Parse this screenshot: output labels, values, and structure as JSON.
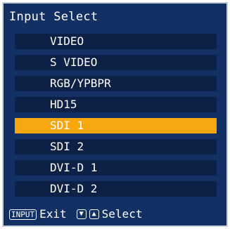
{
  "menu": {
    "title": "Input Select",
    "items": [
      {
        "label": "VIDEO",
        "selected": false
      },
      {
        "label": "S VIDEO",
        "selected": false
      },
      {
        "label": "RGB/YPBPR",
        "selected": false
      },
      {
        "label": "HD15",
        "selected": false
      },
      {
        "label": "SDI 1",
        "selected": true
      },
      {
        "label": "SDI 2",
        "selected": false
      },
      {
        "label": "DVI-D 1",
        "selected": false
      },
      {
        "label": "DVI-D 2",
        "selected": false
      }
    ]
  },
  "footer": {
    "input_key": "INPUT",
    "exit_label": "Exit",
    "down_arrow": "▼",
    "up_arrow": "▲",
    "select_label": "Select"
  },
  "colors": {
    "panel_background": "#123063",
    "item_background": "#0d2045",
    "selected_highlight": "#f6a710",
    "border": "#c9cfd8"
  }
}
